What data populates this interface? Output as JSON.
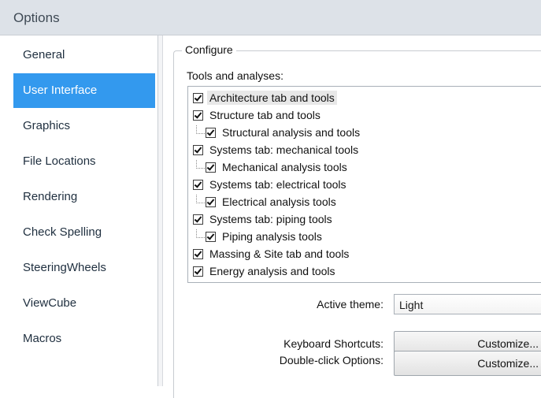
{
  "window": {
    "title": "Options"
  },
  "sidebar": {
    "items": [
      {
        "label": "General"
      },
      {
        "label": "User Interface",
        "selected": true
      },
      {
        "label": "Graphics"
      },
      {
        "label": "File Locations"
      },
      {
        "label": "Rendering"
      },
      {
        "label": "Check Spelling"
      },
      {
        "label": "SteeringWheels"
      },
      {
        "label": "ViewCube"
      },
      {
        "label": "Macros"
      }
    ],
    "selected_color": "#3399ee"
  },
  "configure": {
    "group_label": "Configure",
    "tools_label": "Tools and analyses:",
    "tools": [
      {
        "label": "Architecture tab and tools",
        "checked": true,
        "level": 0
      },
      {
        "label": "Structure tab and tools",
        "checked": true,
        "level": 0
      },
      {
        "label": "Structural analysis and tools",
        "checked": true,
        "level": 1
      },
      {
        "label": "Systems tab: mechanical tools",
        "checked": true,
        "level": 0
      },
      {
        "label": "Mechanical analysis tools",
        "checked": true,
        "level": 1
      },
      {
        "label": "Systems tab: electrical tools",
        "checked": true,
        "level": 0
      },
      {
        "label": "Electrical analysis tools",
        "checked": true,
        "level": 1
      },
      {
        "label": "Systems tab: piping tools",
        "checked": true,
        "level": 0
      },
      {
        "label": "Piping analysis tools",
        "checked": true,
        "level": 1
      },
      {
        "label": "Massing & Site tab and tools",
        "checked": true,
        "level": 0
      },
      {
        "label": "Energy analysis and tools",
        "checked": true,
        "level": 0
      }
    ],
    "active_theme_label": "Active theme:",
    "active_theme_value": "Light",
    "keyboard_shortcuts_label": "Keyboard Shortcuts:",
    "keyboard_shortcuts_button": "Customize...",
    "double_click_label": "Double-click Options:",
    "double_click_button": "Customize..."
  }
}
